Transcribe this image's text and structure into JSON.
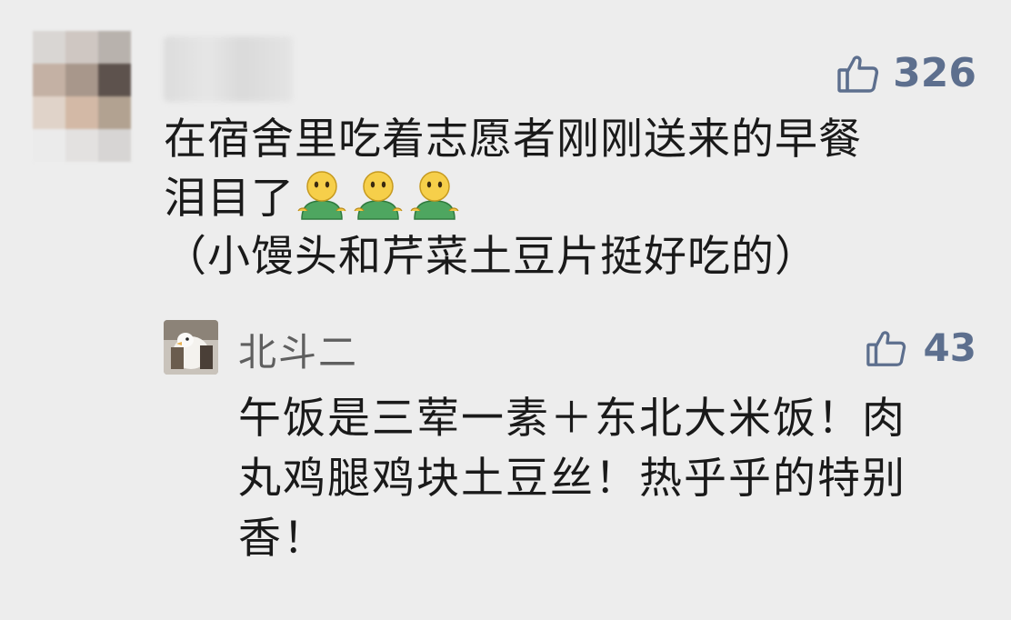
{
  "comment": {
    "like_count": "326",
    "line1": "在宿舍里吃着志愿者刚刚送来的早餐",
    "line2": "泪目了",
    "emoji_name": "person-emoji",
    "line3": "（小馒头和芹菜土豆片挺好吃的）"
  },
  "reply": {
    "author": "北斗二",
    "like_count": "43",
    "line1": "午饭是三荤一素＋东北大米饭！肉",
    "line2": "丸鸡腿鸡块土豆丝！热乎乎的特别",
    "line3": "香！"
  },
  "colors": {
    "background": "#ededed",
    "like_color": "#5d6f8e",
    "text": "#1a1a1a",
    "name": "#5f5f5f"
  }
}
